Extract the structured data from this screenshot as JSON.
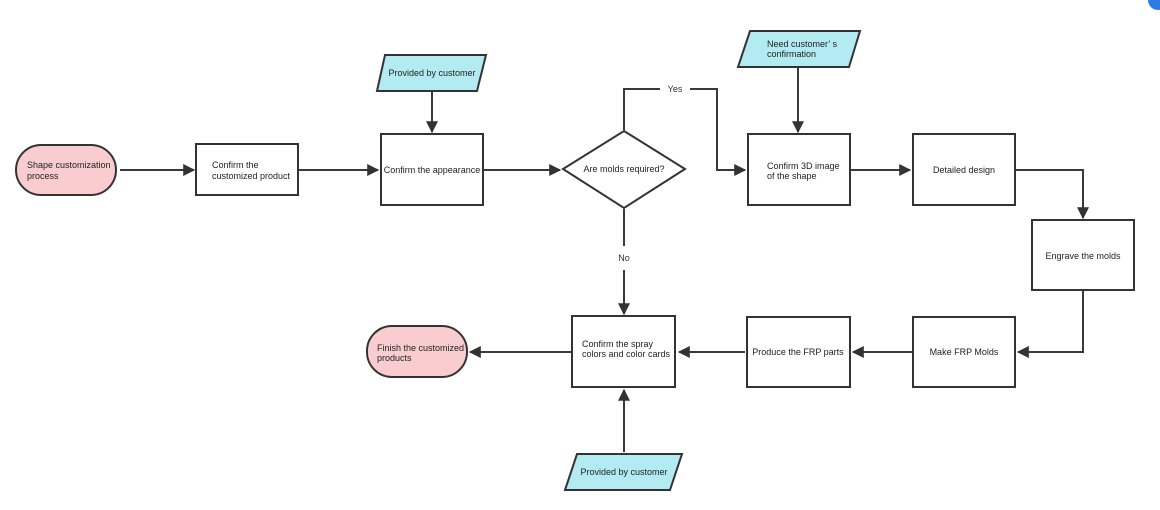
{
  "colors": {
    "terminal_fill": "#f9cdd0",
    "data_fill": "#b2ebf2",
    "process_fill": "#ffffff",
    "stroke": "#333333",
    "badge": "#2d7be5"
  },
  "nodes": {
    "start": {
      "type": "terminal",
      "lines": [
        "Shape customization",
        "process"
      ]
    },
    "confirm_product": {
      "type": "process",
      "lines": [
        "Confirm the",
        "customized product"
      ]
    },
    "provided_1": {
      "type": "data",
      "lines": [
        "Provided by customer"
      ]
    },
    "confirm_appearance": {
      "type": "process",
      "lines": [
        "Confirm the appearance"
      ]
    },
    "molds_decision": {
      "type": "decision",
      "lines": [
        "Are molds required?"
      ]
    },
    "need_confirmation": {
      "type": "data",
      "lines": [
        "Need customer’ s",
        "confirmation"
      ]
    },
    "confirm_3d": {
      "type": "process",
      "lines": [
        "Confirm 3D image",
        "of the shape"
      ]
    },
    "detailed_design": {
      "type": "process",
      "lines": [
        "Detailed design"
      ]
    },
    "engrave_molds": {
      "type": "process",
      "lines": [
        "Engrave the molds"
      ]
    },
    "make_frp_molds": {
      "type": "process",
      "lines": [
        "Make FRP Molds"
      ]
    },
    "produce_frp": {
      "type": "process",
      "lines": [
        "Produce the FRP parts"
      ]
    },
    "confirm_spray": {
      "type": "process",
      "lines": [
        "Confirm the spray",
        "colors and color cards"
      ]
    },
    "provided_2": {
      "type": "data",
      "lines": [
        "Provided by customer"
      ]
    },
    "finish": {
      "type": "terminal",
      "lines": [
        "Finish the customized",
        "products"
      ]
    }
  },
  "edges": [
    {
      "from": "start",
      "to": "confirm_product",
      "label": ""
    },
    {
      "from": "confirm_product",
      "to": "confirm_appearance",
      "label": ""
    },
    {
      "from": "provided_1",
      "to": "confirm_appearance",
      "label": ""
    },
    {
      "from": "confirm_appearance",
      "to": "molds_decision",
      "label": ""
    },
    {
      "from": "molds_decision",
      "to": "confirm_3d",
      "label": "Yes"
    },
    {
      "from": "molds_decision",
      "to": "confirm_spray",
      "label": "No"
    },
    {
      "from": "need_confirmation",
      "to": "confirm_3d",
      "label": ""
    },
    {
      "from": "confirm_3d",
      "to": "detailed_design",
      "label": ""
    },
    {
      "from": "detailed_design",
      "to": "engrave_molds",
      "label": ""
    },
    {
      "from": "engrave_molds",
      "to": "make_frp_molds",
      "label": ""
    },
    {
      "from": "make_frp_molds",
      "to": "produce_frp",
      "label": ""
    },
    {
      "from": "produce_frp",
      "to": "confirm_spray",
      "label": ""
    },
    {
      "from": "provided_2",
      "to": "confirm_spray",
      "label": ""
    },
    {
      "from": "confirm_spray",
      "to": "finish",
      "label": ""
    }
  ],
  "edge_labels": {
    "yes": "Yes",
    "no": "No"
  }
}
